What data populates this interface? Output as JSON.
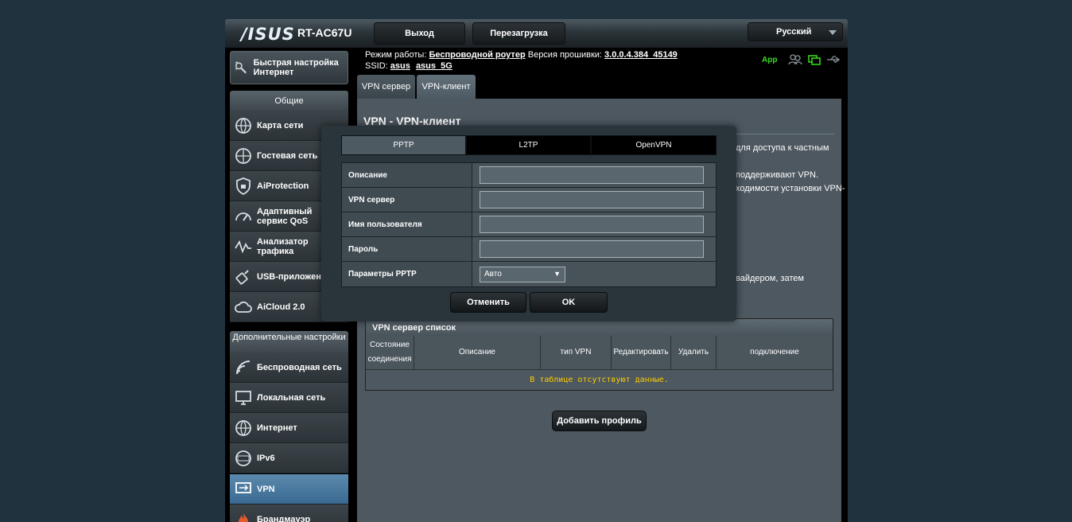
{
  "header": {
    "logo": "/ISUS",
    "model": "RT-AC67U",
    "logout_label": "Выход",
    "reboot_label": "Перезагрузка",
    "language": "Русский"
  },
  "sidebar": {
    "quick_setup": "Быстрая настройка Интернет",
    "general_title": "Общие",
    "general_items": [
      {
        "label": "Карта сети"
      },
      {
        "label": "Гостевая сеть"
      },
      {
        "label": "AiProtection"
      },
      {
        "label": "Адаптивный сервис QoS"
      },
      {
        "label": "Анализатор трафика"
      },
      {
        "label": "USB-приложение"
      },
      {
        "label": "AiCloud 2.0"
      }
    ],
    "advanced_title": "Дополнительные настройки",
    "advanced_items": [
      {
        "label": "Беспроводная сеть"
      },
      {
        "label": "Локальная сеть"
      },
      {
        "label": "Интернет"
      },
      {
        "label": "IPv6"
      },
      {
        "label": "VPN"
      },
      {
        "label": "Брандмауэр"
      }
    ]
  },
  "status": {
    "mode_label": "Режим работы:",
    "mode_value": "Беспроводной роутер",
    "fw_label": "Версия прошивки:",
    "fw_value": "3.0.0.4.384_45149",
    "ssid_label": "SSID:",
    "ssid_1": "asus",
    "ssid_2": "asus_5G",
    "app_label": "App"
  },
  "tabs": [
    {
      "label": "VPN сервер"
    },
    {
      "label": "VPN-клиент"
    }
  ],
  "content": {
    "title": "VPN - VPN-клиент",
    "desc_1": "для доступа к частным",
    "desc_2": "поддерживают VPN.",
    "desc_3": "ходимости установки VPN-",
    "desc_4": "вайдером, затем"
  },
  "vpn_table": {
    "caption": "VPN сервер список",
    "columns": [
      "Состояние соединения",
      "Описание",
      "тип VPN",
      "Редактировать",
      "Удалить",
      "подключение"
    ],
    "empty_text": "В таблице отсутствуют данные."
  },
  "add_profile_label": "Добавить профиль",
  "modal": {
    "protocol_tabs": [
      "PPTP",
      "L2TP",
      "OpenVPN"
    ],
    "fields": [
      {
        "label": "Описание",
        "value": ""
      },
      {
        "label": "VPN сервер",
        "value": ""
      },
      {
        "label": "Имя пользователя",
        "value": ""
      },
      {
        "label": "Пароль",
        "value": ""
      }
    ],
    "pptp_label": "Параметры PPTP",
    "pptp_value": "Авто",
    "cancel_label": "Отменить",
    "ok_label": "OK"
  },
  "colors": {
    "accent_green": "#3adf1c",
    "empty_text": "#ffcc00",
    "active_menu": "#3a6a92"
  }
}
